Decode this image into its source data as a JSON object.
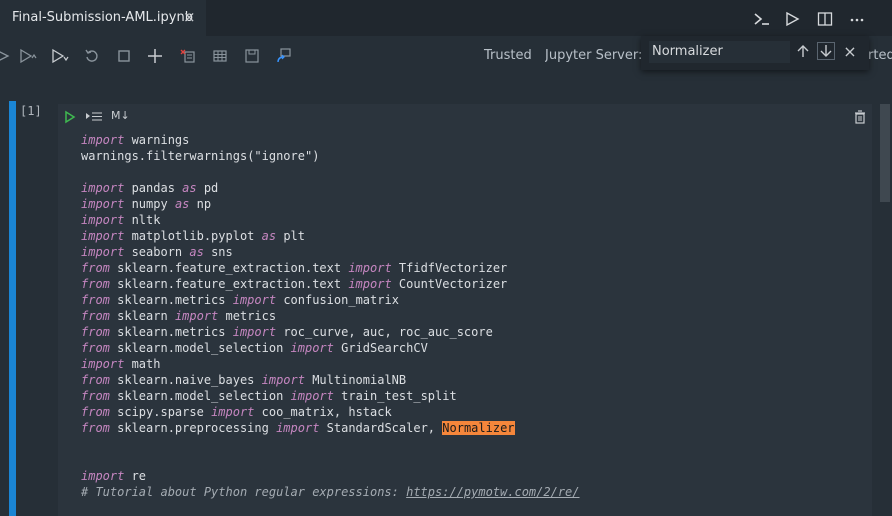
{
  "tab": {
    "title": "Final-Submission-AML.ipynb",
    "close": "×"
  },
  "toolbar": {
    "trusted": "Trusted",
    "server": "Jupyter Server: l",
    "right_overflow": "rted"
  },
  "find": {
    "value": "Normalizer",
    "close": "×"
  },
  "cell": {
    "prompt": "[1]",
    "md_label": "M↓",
    "lines": [
      [
        {
          "t": "import",
          "c": "kw"
        },
        {
          "t": " warnings"
        }
      ],
      [
        {
          "t": "warnings."
        },
        {
          "t": "filterwarnings",
          "c": "fn"
        },
        {
          "t": "(\"ignore\")"
        }
      ],
      [],
      [
        {
          "t": "import",
          "c": "kw"
        },
        {
          "t": " pandas "
        },
        {
          "t": "as",
          "c": "kw"
        },
        {
          "t": " pd"
        }
      ],
      [
        {
          "t": "import",
          "c": "kw"
        },
        {
          "t": " numpy "
        },
        {
          "t": "as",
          "c": "kw"
        },
        {
          "t": " np"
        }
      ],
      [
        {
          "t": "import",
          "c": "kw"
        },
        {
          "t": " nltk"
        }
      ],
      [
        {
          "t": "import",
          "c": "kw"
        },
        {
          "t": " matplotlib.pyplot "
        },
        {
          "t": "as",
          "c": "kw"
        },
        {
          "t": " plt"
        }
      ],
      [
        {
          "t": "import",
          "c": "kw"
        },
        {
          "t": " seaborn "
        },
        {
          "t": "as",
          "c": "kw"
        },
        {
          "t": " sns"
        }
      ],
      [
        {
          "t": "from",
          "c": "kw"
        },
        {
          "t": " sklearn.feature_extraction.text "
        },
        {
          "t": "import",
          "c": "kw"
        },
        {
          "t": " TfidfVectorizer"
        }
      ],
      [
        {
          "t": "from",
          "c": "kw"
        },
        {
          "t": " sklearn.feature_extraction.text "
        },
        {
          "t": "import",
          "c": "kw"
        },
        {
          "t": " CountVectorizer"
        }
      ],
      [
        {
          "t": "from",
          "c": "kw"
        },
        {
          "t": " sklearn.metrics "
        },
        {
          "t": "import",
          "c": "kw"
        },
        {
          "t": " confusion_matrix"
        }
      ],
      [
        {
          "t": "from",
          "c": "kw"
        },
        {
          "t": " sklearn "
        },
        {
          "t": "import",
          "c": "kw"
        },
        {
          "t": " metrics"
        }
      ],
      [
        {
          "t": "from",
          "c": "kw"
        },
        {
          "t": " sklearn.metrics "
        },
        {
          "t": "import",
          "c": "kw"
        },
        {
          "t": " roc_curve, auc, roc_auc_score"
        }
      ],
      [
        {
          "t": "from",
          "c": "kw"
        },
        {
          "t": " sklearn.model_selection "
        },
        {
          "t": "import",
          "c": "kw"
        },
        {
          "t": " GridSearchCV"
        }
      ],
      [
        {
          "t": "import",
          "c": "kw"
        },
        {
          "t": " math"
        }
      ],
      [
        {
          "t": "from",
          "c": "kw"
        },
        {
          "t": " sklearn.naive_bayes "
        },
        {
          "t": "import",
          "c": "kw"
        },
        {
          "t": " MultinomialNB"
        }
      ],
      [
        {
          "t": "from",
          "c": "kw"
        },
        {
          "t": " sklearn.model_selection "
        },
        {
          "t": "import",
          "c": "kw"
        },
        {
          "t": " train_test_split"
        }
      ],
      [
        {
          "t": "from",
          "c": "kw"
        },
        {
          "t": " scipy.sparse "
        },
        {
          "t": "import",
          "c": "kw"
        },
        {
          "t": " coo_matrix, hstack"
        }
      ],
      [
        {
          "t": "from",
          "c": "kw"
        },
        {
          "t": " sklearn.preprocessing "
        },
        {
          "t": "import",
          "c": "kw"
        },
        {
          "t": " StandardScaler, "
        },
        {
          "t": "Normalizer",
          "c": "hl"
        }
      ],
      [],
      [],
      [
        {
          "t": "import",
          "c": "kw"
        },
        {
          "t": " re"
        }
      ],
      [
        {
          "t": "# Tutorial about Python regular expressions: ",
          "c": "cmt"
        },
        {
          "t": "https://pymotw.com/2/re/",
          "c": "cmt link"
        }
      ]
    ]
  }
}
